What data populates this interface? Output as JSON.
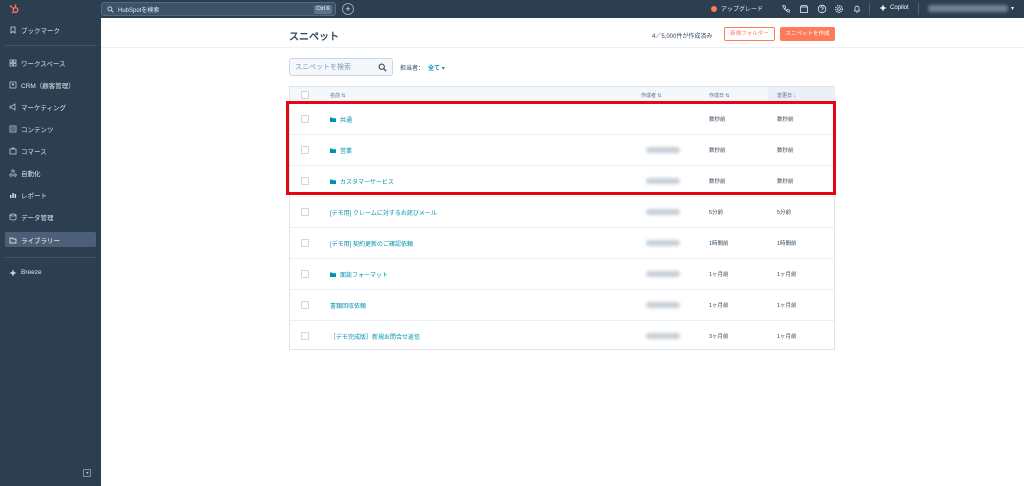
{
  "sidebar": {
    "items": [
      {
        "label": "ブックマーク",
        "icon": "bookmark-icon"
      },
      {
        "label": "ワークスペース",
        "icon": "workspace-icon"
      },
      {
        "label": "CRM（顧客管理）",
        "icon": "crm-icon"
      },
      {
        "label": "マーケティング",
        "icon": "megaphone-icon"
      },
      {
        "label": "コンテンツ",
        "icon": "content-icon"
      },
      {
        "label": "コマース",
        "icon": "commerce-icon"
      },
      {
        "label": "自動化",
        "icon": "automation-icon"
      },
      {
        "label": "レポート",
        "icon": "report-icon"
      },
      {
        "label": "データ管理",
        "icon": "database-icon"
      },
      {
        "label": "ライブラリー",
        "icon": "library-icon",
        "active": true
      },
      {
        "label": "Breeze",
        "icon": "breeze-icon"
      }
    ]
  },
  "topbar": {
    "search_placeholder": "HubSpotを検索",
    "shortcut": "Ctrl K",
    "upgrade_label": "アップグレード",
    "copilot_label": "Copilot"
  },
  "main": {
    "title": "スニペット",
    "count_text": "4／5,000件が作成済み",
    "new_folder_button": "新規フォルダー",
    "create_button": "スニペットを作成",
    "search_placeholder": "スニペットを検索",
    "owner_label": "担当者：",
    "owner_value": "全て"
  },
  "table": {
    "columns": [
      "名前",
      "作成者",
      "作成日",
      "変更日"
    ],
    "rows": [
      {
        "name": "共通",
        "folder": true,
        "created": "数秒前",
        "modified": "数秒前",
        "creator_blurred": false
      },
      {
        "name": "営業",
        "folder": true,
        "created": "数秒前",
        "modified": "数秒前",
        "creator_blurred": true
      },
      {
        "name": "カスタマーサービス",
        "folder": true,
        "created": "数秒前",
        "modified": "数秒前",
        "creator_blurred": true
      },
      {
        "name": "[デモ用] クレームに対するお詫びメール",
        "folder": false,
        "created": "5分前",
        "modified": "5分前",
        "creator_blurred": true
      },
      {
        "name": "[デモ用] 契約更新のご確認依頼",
        "folder": false,
        "created": "1時間前",
        "modified": "1時間前",
        "creator_blurred": true
      },
      {
        "name": "面談フォーマット",
        "folder": true,
        "created": "1ヶ月前",
        "modified": "1ヶ月前",
        "creator_blurred": true
      },
      {
        "name": "書類回収依頼",
        "folder": false,
        "created": "1ヶ月前",
        "modified": "1ヶ月前",
        "creator_blurred": true
      },
      {
        "name": "［デモ完成版］新規お問合せ返信",
        "folder": false,
        "created": "3ヶ月前",
        "modified": "1ヶ月前",
        "creator_blurred": true
      }
    ]
  },
  "colors": {
    "sidebar_bg": "#2d3e50",
    "accent_orange": "#ff7a59",
    "link_teal": "#0091ae",
    "highlight_red": "#e30613"
  }
}
